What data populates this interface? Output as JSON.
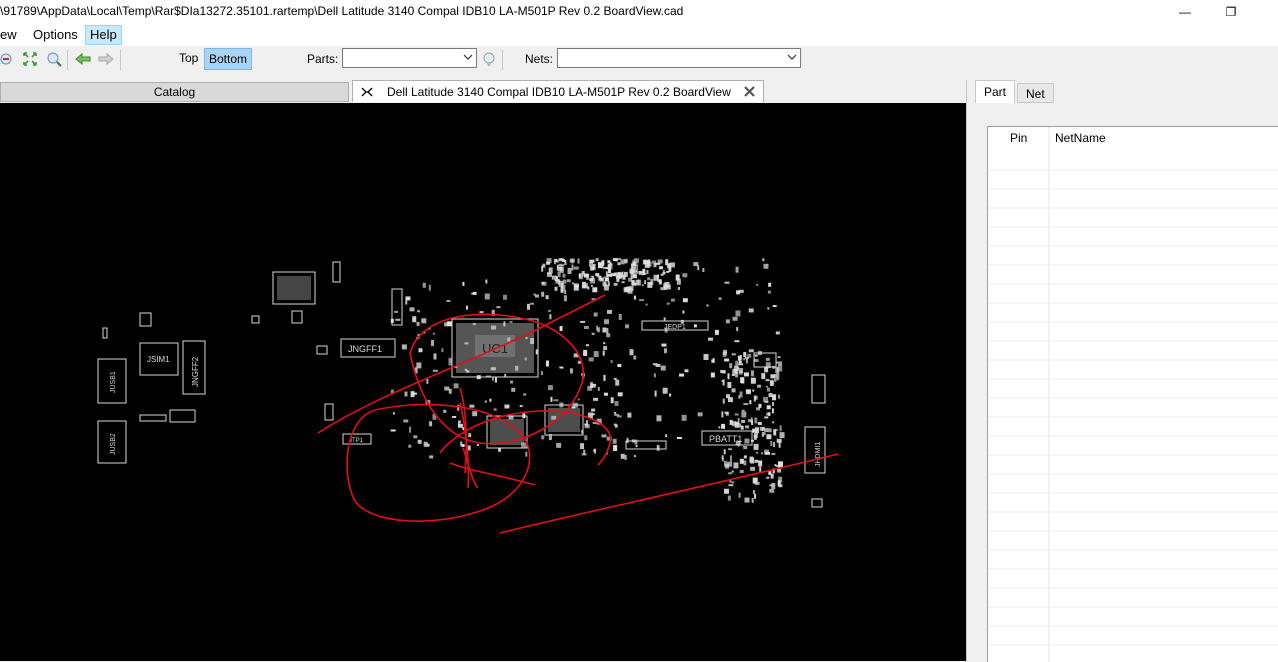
{
  "window": {
    "title": "\\91789\\AppData\\Local\\Temp\\Rar$DIa13272.35101.rartemp\\Dell Latitude 3140 Compal IDB10 LA-M501P Rev 0.2 BoardView.cad",
    "minimize": "—",
    "maximize": "❐",
    "close": "✕"
  },
  "menu": {
    "items": [
      "ew",
      "Options",
      "Help"
    ]
  },
  "toolbar": {
    "top_label": "Top",
    "bottom_label": "Bottom",
    "parts_label": "Parts:",
    "parts_value": "",
    "nets_label": "Nets:",
    "nets_value": ""
  },
  "tabs": {
    "catalog": "Catalog",
    "board": "Dell Latitude 3140 Compal IDB10 LA-M501P Rev 0.2 BoardView"
  },
  "board_labels": {
    "uc1": "UC1",
    "jngff1": "JNGFF1",
    "jngff2": "JNGFF2",
    "jsim1": "JSIM1",
    "jusb1": "JUSB1",
    "jusb2": "JUSB2",
    "jedp1": "JEDP1",
    "pbatt1": "PBATT1",
    "jhdmi1": "JHDMI1",
    "jtp1": "JTP1"
  },
  "right_panel": {
    "tabs": [
      "Part",
      "Net"
    ],
    "columns": [
      "Pin",
      "NetName"
    ]
  },
  "colors": {
    "annotation": "#e0101a",
    "pcb_text": "#d8d8d8"
  }
}
